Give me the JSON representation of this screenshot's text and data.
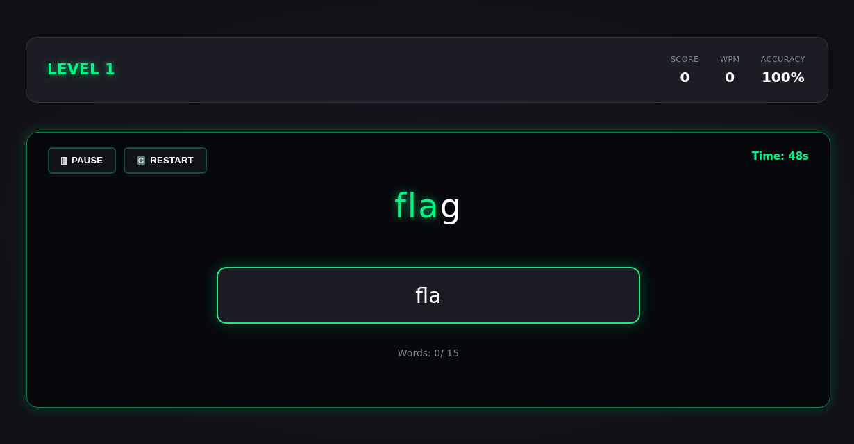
{
  "header": {
    "level": "LEVEL 1",
    "stats": [
      {
        "label": "SCORE",
        "value": "0"
      },
      {
        "label": "WPM",
        "value": "0"
      },
      {
        "label": "ACCURACY",
        "value": "100%"
      }
    ]
  },
  "game": {
    "buttons": [
      {
        "kind": "pause",
        "label": "PAUSE"
      },
      {
        "kind": "restart",
        "label": "RESTART"
      }
    ],
    "timer": "Time: 48s",
    "word": [
      {
        "char": "f",
        "typed": true
      },
      {
        "char": "l",
        "typed": true
      },
      {
        "char": "a",
        "typed": true
      },
      {
        "char": "g",
        "typed": false
      }
    ],
    "input": {
      "value": "fla"
    },
    "progress": "Words: 0/ 15"
  }
}
